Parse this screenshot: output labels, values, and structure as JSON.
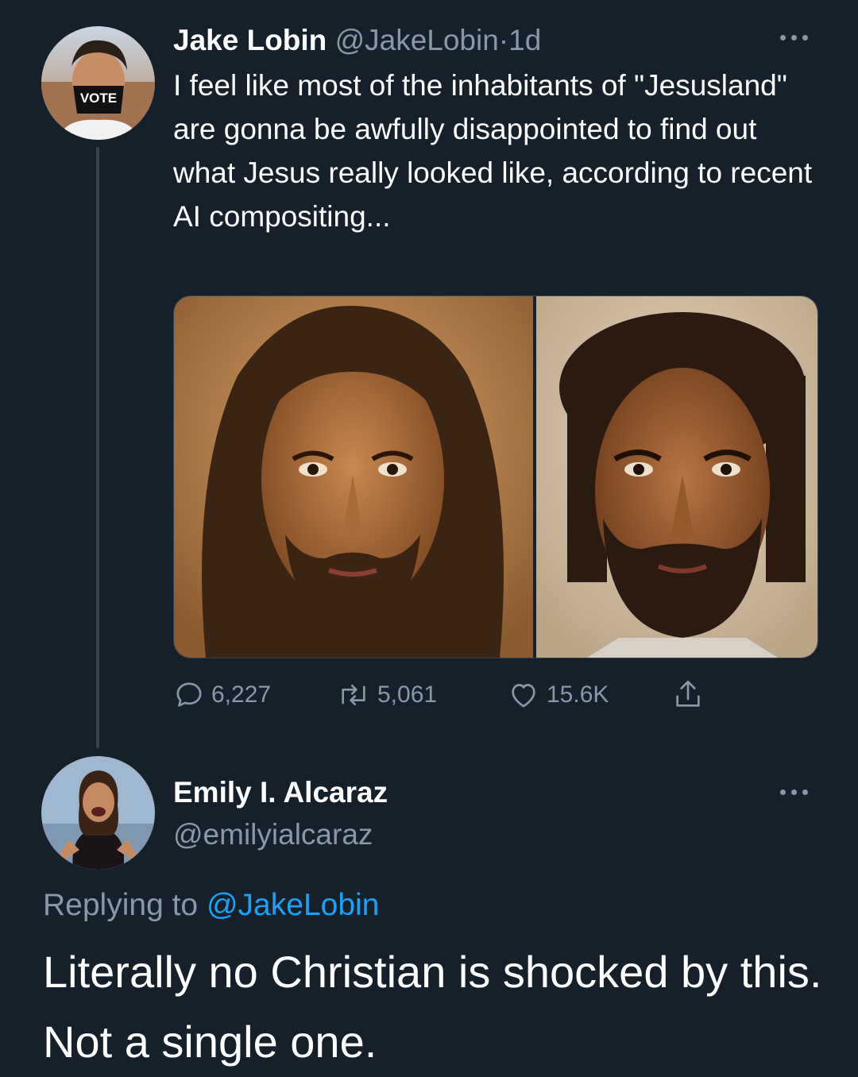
{
  "tweet": {
    "author_name": "Jake Lobin",
    "author_handle": "@JakeLobin",
    "separator": "·",
    "time": "1d",
    "text": "I feel like most of the inhabitants of \"Jesusland\" are gonna be awfully disappointed to find out what Jesus really looked like, according to recent AI compositing...",
    "avatar_mask_text": "VOTE",
    "stats": {
      "replies": "6,227",
      "retweets": "5,061",
      "likes": "15.6K"
    }
  },
  "reply": {
    "author_name": "Emily I. Alcaraz",
    "author_handle": "@emilyialcaraz",
    "replying_prefix": "Replying to",
    "replying_mention": "@JakeLobin",
    "text": "Literally no Christian is shocked by this. Not a single one."
  },
  "colors": {
    "background": "#15202b",
    "secondary_text": "#8899a6",
    "link": "#1da1f2",
    "divider": "#38444d"
  },
  "icons": [
    "reply-icon",
    "retweet-icon",
    "like-icon",
    "share-icon",
    "more-icon"
  ]
}
